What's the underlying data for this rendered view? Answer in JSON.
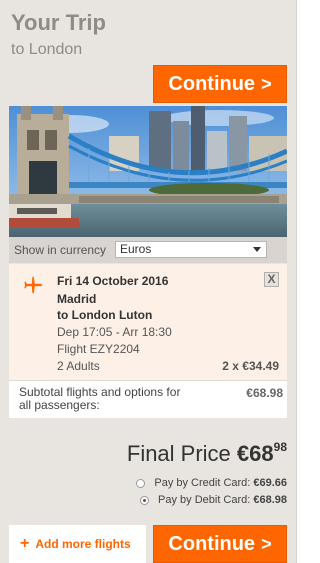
{
  "header": {
    "title": "Your Trip",
    "subtitle": "to London"
  },
  "buttons": {
    "continue_label": "Continue",
    "continue_chevron": ">",
    "add_flights_label": "Add more flights",
    "add_flights_icon": "+"
  },
  "currency": {
    "label": "Show in currency",
    "selected": "Euros"
  },
  "flight": {
    "date": "Fri 14 October 2016",
    "from": "Madrid",
    "to": "to London Luton",
    "times": "Dep 17:05 - Arr 18:30",
    "flight_number": "Flight EZY2204",
    "passengers": "2 Adults",
    "price": "2 x €34.49",
    "remove_label": "X",
    "icon": "plane-icon"
  },
  "subtotal": {
    "label": "Subtotal flights and options for all passengers:",
    "value": "€68.98"
  },
  "final_price": {
    "label": "Final Price",
    "amount": "€68",
    "cents": "98"
  },
  "payment_options": [
    {
      "label": "Pay by Credit Card:",
      "value": "€69.66",
      "selected": false
    },
    {
      "label": "Pay by Debit Card:",
      "value": "€68.98",
      "selected": true
    }
  ],
  "colors": {
    "accent": "#ff6600",
    "panel_bg": "#e8e4df",
    "card_bg": "#fdf0e6"
  }
}
